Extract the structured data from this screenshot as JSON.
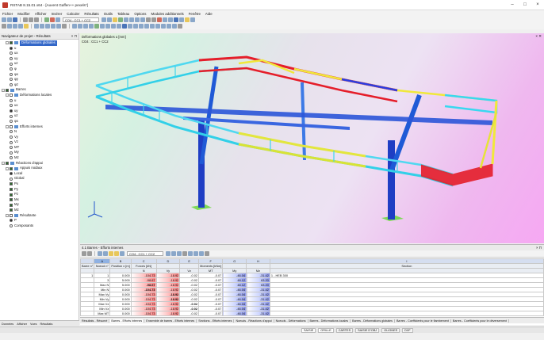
{
  "window": {
    "title": "RSTAB 8.15.01 x64 - [Auvent Gaffen++ pexels*]"
  },
  "menu": [
    "Fichier",
    "Modifier",
    "Afficher",
    "Insérer",
    "Calculer",
    "Résultats",
    "Outils",
    "Tableau",
    "Options",
    "Modules additionnels",
    "Fenêtre",
    "Aide"
  ],
  "toolbar": {
    "loadcase_combo": "CO4 : CC1 + CC2",
    "table_combo": "CO4 : CC1 + CC2"
  },
  "navigator": {
    "title": "Navigateur de projet - Résultats",
    "nodes": [
      {
        "label": "Déformations globales",
        "indent": 1,
        "kind": "check",
        "on": true,
        "expand": "-",
        "selected": true
      },
      {
        "label": "u",
        "indent": 2,
        "kind": "radio",
        "on": true
      },
      {
        "label": "ux",
        "indent": 2,
        "kind": "radio",
        "on": false
      },
      {
        "label": "uy",
        "indent": 2,
        "kind": "radio",
        "on": false
      },
      {
        "label": "uz",
        "indent": 2,
        "kind": "radio",
        "on": false
      },
      {
        "label": "φ",
        "indent": 2,
        "kind": "radio",
        "on": false
      },
      {
        "label": "φx",
        "indent": 2,
        "kind": "radio",
        "on": false
      },
      {
        "label": "φy",
        "indent": 2,
        "kind": "radio",
        "on": false
      },
      {
        "label": "φz",
        "indent": 2,
        "kind": "radio",
        "on": false
      },
      {
        "label": "Barres",
        "indent": 0,
        "kind": "check",
        "on": true,
        "expand": "-"
      },
      {
        "label": "Déformations locales",
        "indent": 1,
        "kind": "check",
        "on": false,
        "expand": "-"
      },
      {
        "label": "u",
        "indent": 2,
        "kind": "radio",
        "on": false
      },
      {
        "label": "ux",
        "indent": 2,
        "kind": "radio",
        "on": false
      },
      {
        "label": "uy",
        "indent": 2,
        "kind": "radio",
        "on": true
      },
      {
        "label": "uz",
        "indent": 2,
        "kind": "radio",
        "on": false
      },
      {
        "label": "φx",
        "indent": 2,
        "kind": "radio",
        "on": false
      },
      {
        "label": "Efforts internes",
        "indent": 1,
        "kind": "check",
        "on": false,
        "expand": "-"
      },
      {
        "label": "N",
        "indent": 2,
        "kind": "radio",
        "on": false
      },
      {
        "label": "Vy",
        "indent": 2,
        "kind": "radio",
        "on": false
      },
      {
        "label": "Vz",
        "indent": 2,
        "kind": "radio",
        "on": false
      },
      {
        "label": "MT",
        "indent": 2,
        "kind": "radio",
        "on": false
      },
      {
        "label": "My",
        "indent": 2,
        "kind": "radio",
        "on": false
      },
      {
        "label": "Mz",
        "indent": 2,
        "kind": "radio",
        "on": false
      },
      {
        "label": "Réactions d'appui",
        "indent": 0,
        "kind": "check",
        "on": true,
        "expand": "-"
      },
      {
        "label": "Appuis nodaux",
        "indent": 1,
        "kind": "check",
        "on": true,
        "expand": "-"
      },
      {
        "label": "Local",
        "indent": 2,
        "kind": "radio",
        "on": true
      },
      {
        "label": "Global",
        "indent": 2,
        "kind": "radio",
        "on": false
      },
      {
        "label": "Px",
        "indent": 2,
        "kind": "check",
        "on": true
      },
      {
        "label": "Py",
        "indent": 2,
        "kind": "check",
        "on": true
      },
      {
        "label": "Pz",
        "indent": 2,
        "kind": "check",
        "on": true
      },
      {
        "label": "Mx",
        "indent": 2,
        "kind": "check",
        "on": true
      },
      {
        "label": "My",
        "indent": 2,
        "kind": "check",
        "on": true
      },
      {
        "label": "Mz",
        "indent": 2,
        "kind": "check",
        "on": true
      },
      {
        "label": "Résultante",
        "indent": 1,
        "kind": "check",
        "on": false,
        "expand": "-"
      },
      {
        "label": "P",
        "indent": 2,
        "kind": "radio",
        "on": true
      },
      {
        "label": "Composants",
        "indent": 2,
        "kind": "radio",
        "on": false
      }
    ],
    "tabs": [
      "Données",
      "Afficher",
      "Vues",
      "Résultats"
    ]
  },
  "viewport": {
    "label1": "Déformations globales u [mm]",
    "label2": "CO4 : CC1 + CC2"
  },
  "table": {
    "title": "4.1 Barres - Efforts internes",
    "col_letters": [
      "A",
      "B",
      "C",
      "D",
      "E",
      "F",
      "G",
      "H",
      "I"
    ],
    "header1": [
      "Barre n°",
      "Noeud n°",
      "Position x [m]",
      "Forces [kN]",
      "",
      "",
      "Moments [kNm]",
      "",
      "",
      "Section"
    ],
    "header2": [
      "",
      "",
      "",
      "N",
      "Vy",
      "Vz",
      "MT",
      "My",
      "Mz",
      ""
    ],
    "rows": [
      [
        "1",
        "1",
        "0.000",
        "-104.73",
        "-18.92",
        "-0.02",
        "-0.07",
        "-46.04",
        "-31.42",
        "1 - HEB 300"
      ],
      [
        "",
        "3",
        "5.000",
        "-98.67",
        "-18.92",
        "-0.02",
        "-0.07",
        "48.12",
        "63.20",
        ""
      ],
      [
        "",
        "Max N",
        "5.000",
        "-98.67",
        "-18.92",
        "-0.02",
        "-0.07",
        "48.12",
        "63.20",
        ""
      ],
      [
        "",
        "Min N",
        "0.000",
        "-104.73",
        "-18.92",
        "-0.02",
        "-0.07",
        "-46.04",
        "-31.42",
        ""
      ],
      [
        "",
        "Max Vy",
        "0.000",
        "-104.73",
        "-18.92",
        "-0.02",
        "-0.07",
        "-46.04",
        "-31.42",
        ""
      ],
      [
        "",
        "Min Vy",
        "0.000",
        "-104.73",
        "-18.92",
        "-0.02",
        "-0.07",
        "-46.04",
        "-31.42",
        ""
      ],
      [
        "",
        "Max Vz",
        "0.000",
        "-104.73",
        "-18.92",
        "-0.02",
        "-0.07",
        "-46.04",
        "-31.42",
        ""
      ],
      [
        "",
        "Min Vz",
        "0.000",
        "-104.73",
        "-18.92",
        "-0.02",
        "-0.07",
        "-46.04",
        "-31.42",
        ""
      ],
      [
        "",
        "Max MT",
        "0.000",
        "-104.73",
        "-18.92",
        "-0.02",
        "-0.07",
        "-46.04",
        "-31.42",
        ""
      ]
    ],
    "tabs": [
      "Résultats - Résumé",
      "Barres - Efforts internes",
      "Ensemble de barres - Efforts internes",
      "Sections - Efforts internes",
      "Noeuds - Réactions d'appui",
      "Noeuds - Déformations",
      "Barres - Déformations locales",
      "Barres - Déformations globales",
      "Barres - Coefficients pour le flambement",
      "Barres - Coefficients pour le déversement"
    ]
  },
  "status": [
    "SAISIE",
    "GRILLE",
    "CARTES",
    "SAISIE D'OBJ",
    "GLIGNES",
    "DXF"
  ]
}
